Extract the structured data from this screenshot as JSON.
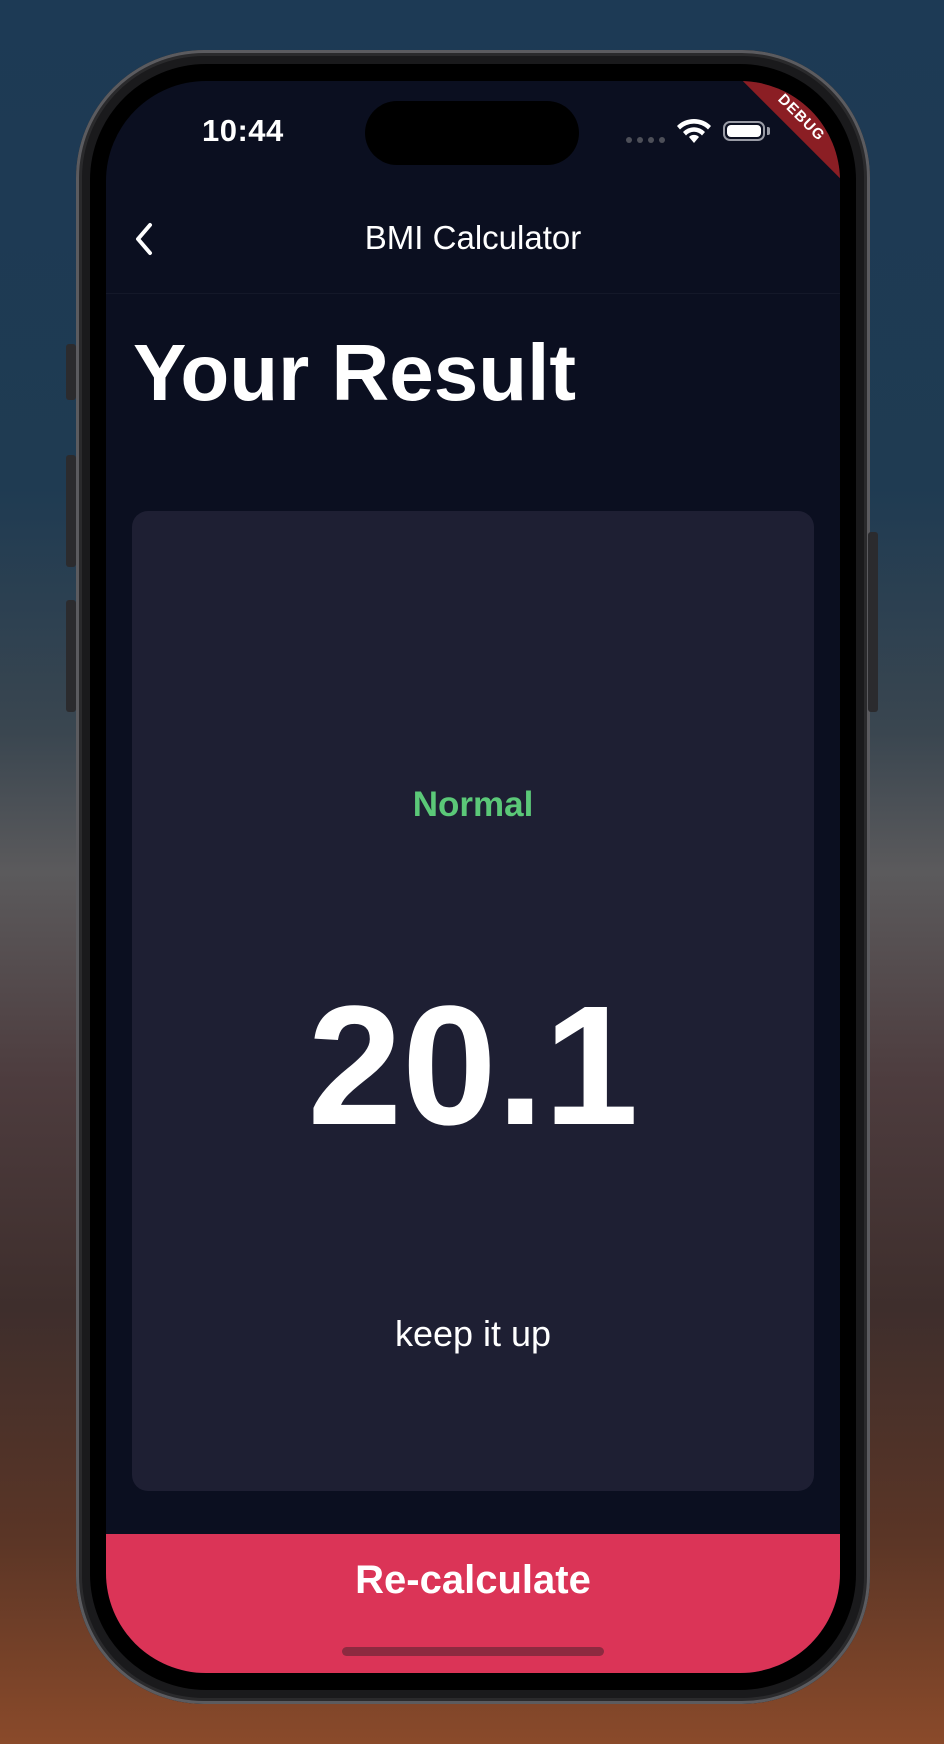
{
  "status_bar": {
    "time": "10:44",
    "icons": [
      "signal-dots-icon",
      "wifi-icon",
      "battery-icon"
    ]
  },
  "debug_banner": "DEBUG",
  "app_bar": {
    "back_icon": "chevron-left-icon",
    "title": "BMI Calculator"
  },
  "main": {
    "heading": "Your Result",
    "result": {
      "category": "Normal",
      "value": "20.1",
      "advice": "keep it up"
    },
    "recalculate_label": "Re-calculate"
  },
  "colors": {
    "background": "#0b0f20",
    "card": "#1e1f33",
    "category_normal": "#5bc878",
    "button": "#db3457",
    "debug_banner": "#8b1e24"
  }
}
